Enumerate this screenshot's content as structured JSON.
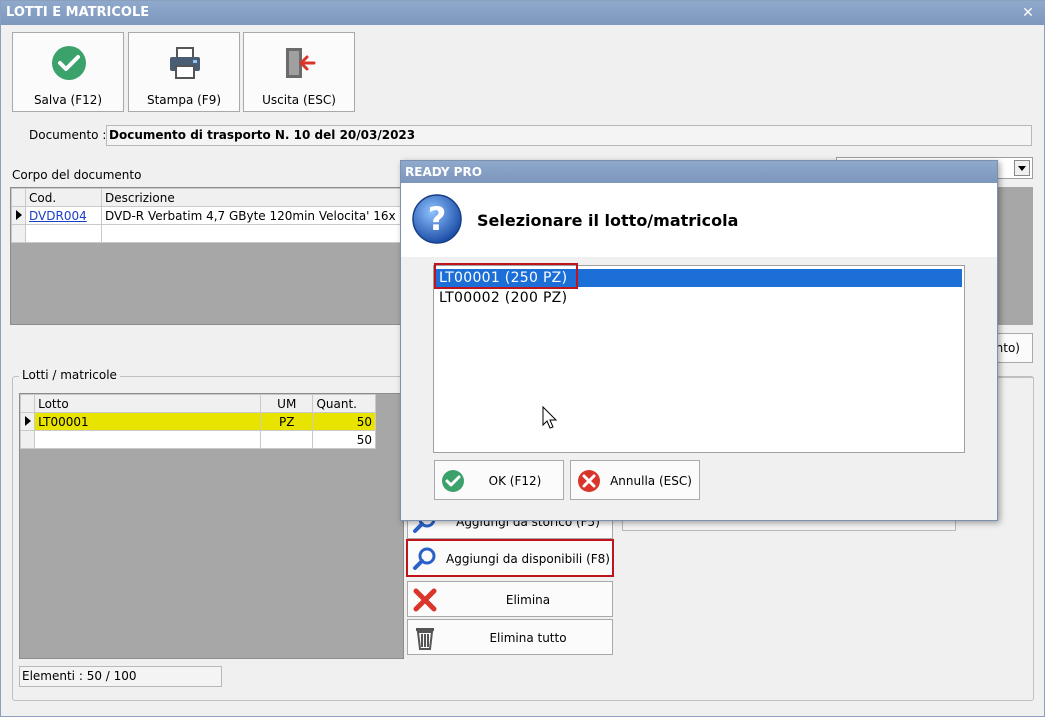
{
  "window": {
    "title": "LOTTI E MATRICOLE",
    "close_glyph": "✕"
  },
  "toolbar": {
    "save_label": "Salva (F12)",
    "print_label": "Stampa (F9)",
    "exit_label": "Uscita (ESC)"
  },
  "document": {
    "label": "Documento :",
    "value": "Documento di trasporto N. 10 del 20/03/2023"
  },
  "body_section": {
    "title": "Corpo del documento",
    "columns": [
      "Cod.",
      "Descrizione"
    ],
    "rows": [
      {
        "code": "DVDR004",
        "description": "DVD-R Verbatim 4,7 GByte 120min  Velocita' 16x"
      }
    ],
    "partial_button_label": "nto)"
  },
  "lots_section": {
    "title": "Lotti / matricole",
    "columns": [
      "Lotto",
      "UM",
      "Quant."
    ],
    "rows": [
      {
        "lotto": "LT00001",
        "um": "PZ",
        "quant": "50"
      }
    ],
    "total_quant": "50",
    "elements_label": "Elementi : 50 / 100"
  },
  "side_buttons": {
    "from_history_label": "Aggiungi da storico (F5)",
    "from_available_label": "Aggiungi da disponibili (F8)",
    "delete_label": "Elimina",
    "delete_all_label": "Elimina tutto"
  },
  "dialog": {
    "title": "READY PRO",
    "message": "Selezionare il lotto/matricola",
    "options": [
      "LT00001  (250 PZ)",
      "LT00002  (200 PZ)"
    ],
    "selected_index": 0,
    "ok_label": "OK (F12)",
    "cancel_label": "Annulla (ESC)"
  },
  "colors": {
    "title_bar": "#8fa9cd",
    "highlight_row": "#e8e400",
    "selection": "#1c6fd6",
    "emphasis_frame": "#c0141c",
    "ok_green": "#3aa26a",
    "cancel_red": "#d9352b"
  }
}
